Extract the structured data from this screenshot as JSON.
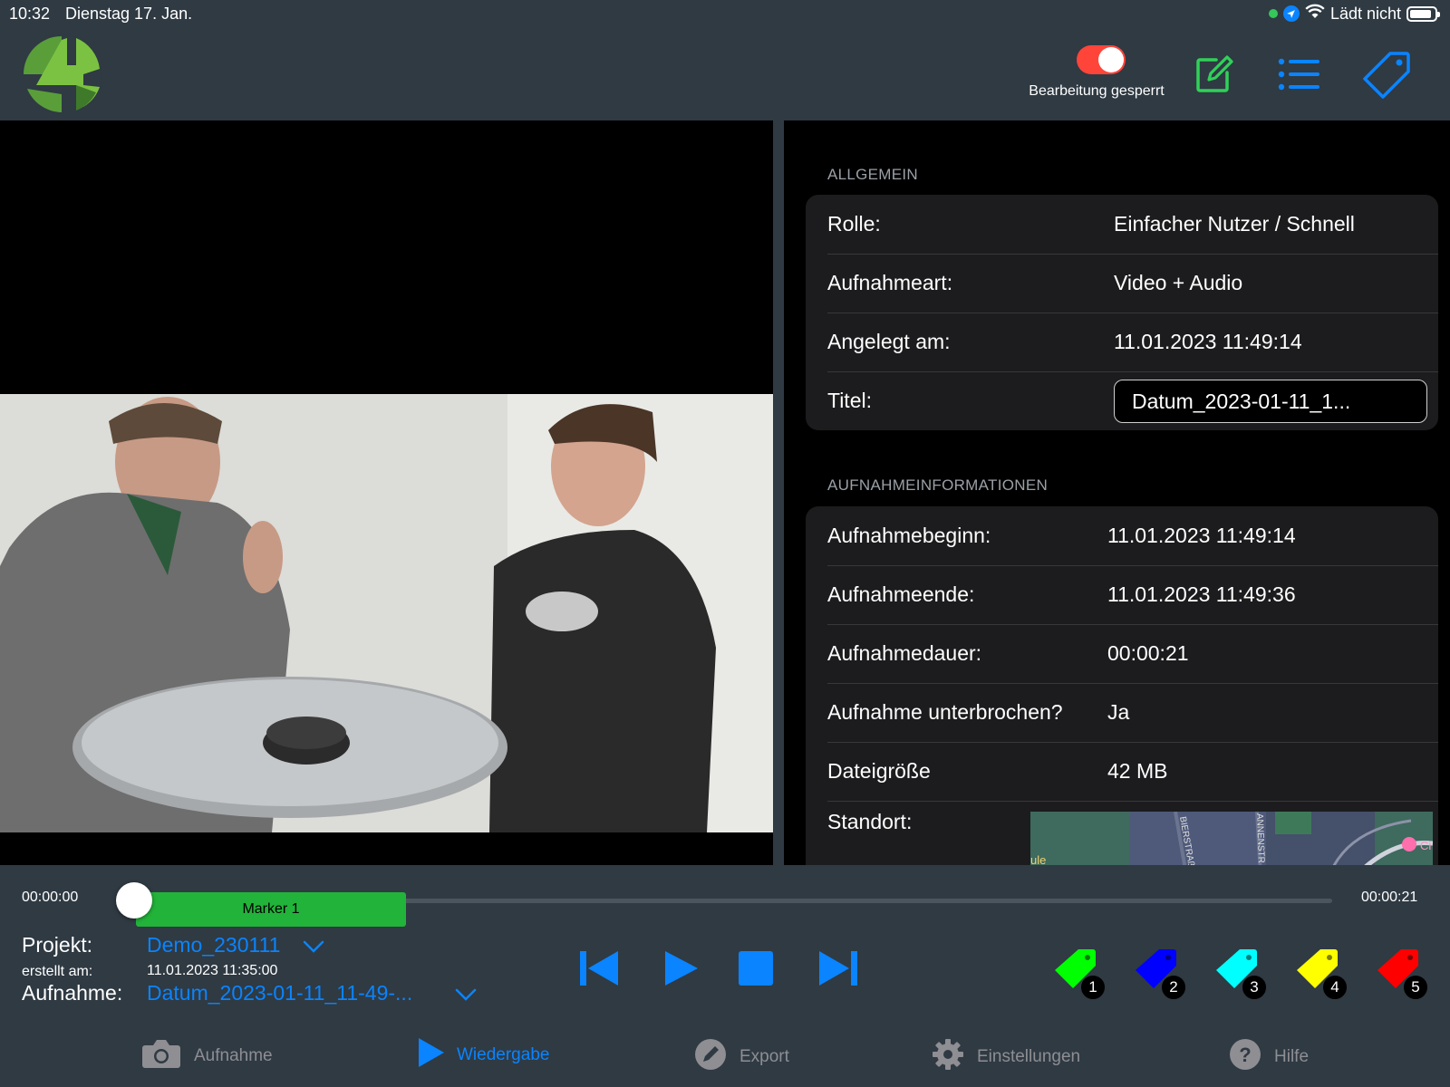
{
  "status": {
    "time": "10:32",
    "date": "Dienstag 17. Jan.",
    "charging": "Lädt nicht",
    "battery_level": 0.9
  },
  "header": {
    "edit_lock_label": "Bearbeitung gesperrt",
    "edit_lock_on": true,
    "toggle_color": "#ff453a",
    "note_icon": "note-edit-icon",
    "list_icon": "list-icon",
    "tag_icon": "tag-icon"
  },
  "info": {
    "general": {
      "header": "ALLGEMEIN",
      "rows": [
        {
          "label": "Rolle:",
          "value": "Einfacher Nutzer / Schnell"
        },
        {
          "label": "Aufnahmeart:",
          "value": "Video + Audio"
        },
        {
          "label": "Angelegt am:",
          "value": "11.01.2023 11:49:14"
        },
        {
          "label": "Titel:",
          "value": "Datum_2023-01-11_1..."
        }
      ]
    },
    "recording": {
      "header": "AUFNAHMEINFORMATIONEN",
      "rows": [
        {
          "label": "Aufnahmebeginn:",
          "value": "11.01.2023 11:49:14"
        },
        {
          "label": "Aufnahmeende:",
          "value": "11.01.2023 11:49:36"
        },
        {
          "label": "Aufnahmedauer:",
          "value": "00:00:21"
        },
        {
          "label": "Aufnahme unterbrochen?",
          "value": "Ja"
        },
        {
          "label": "Dateigröße",
          "value": "42 MB"
        },
        {
          "label": "Standort:",
          "value": ""
        }
      ],
      "map_labels": [
        "BIERSTRAß",
        "ANNENSTR",
        "ule",
        "Ci"
      ]
    }
  },
  "timeline": {
    "start": "00:00:00",
    "end": "00:00:21",
    "marker_label": "Marker 1",
    "marker_color": "#22b33a"
  },
  "project": {
    "project_label": "Projekt:",
    "project_value": "Demo_230111",
    "created_label": "erstellt am:",
    "created_value": "11.01.2023 11:35:00",
    "recording_label": "Aufnahme:",
    "recording_value": "Datum_2023-01-11_11-49-..."
  },
  "color_tags": [
    {
      "num": "1",
      "color": "#00ff00"
    },
    {
      "num": "2",
      "color": "#0000ff"
    },
    {
      "num": "3",
      "color": "#00ffff"
    },
    {
      "num": "4",
      "color": "#ffff00"
    },
    {
      "num": "5",
      "color": "#ff0000"
    }
  ],
  "tabs": [
    {
      "label": "Aufnahme",
      "icon": "camera-icon",
      "active": false
    },
    {
      "label": "Wiedergabe",
      "icon": "play-icon",
      "active": true
    },
    {
      "label": "Export",
      "icon": "pencil-icon",
      "active": false
    },
    {
      "label": "Einstellungen",
      "icon": "gear-icon",
      "active": false
    },
    {
      "label": "Hilfe",
      "icon": "help-icon",
      "active": false
    }
  ],
  "colors": {
    "accent": "#0a84ff",
    "background": "#2f3a43",
    "note_icon": "#30d158"
  }
}
